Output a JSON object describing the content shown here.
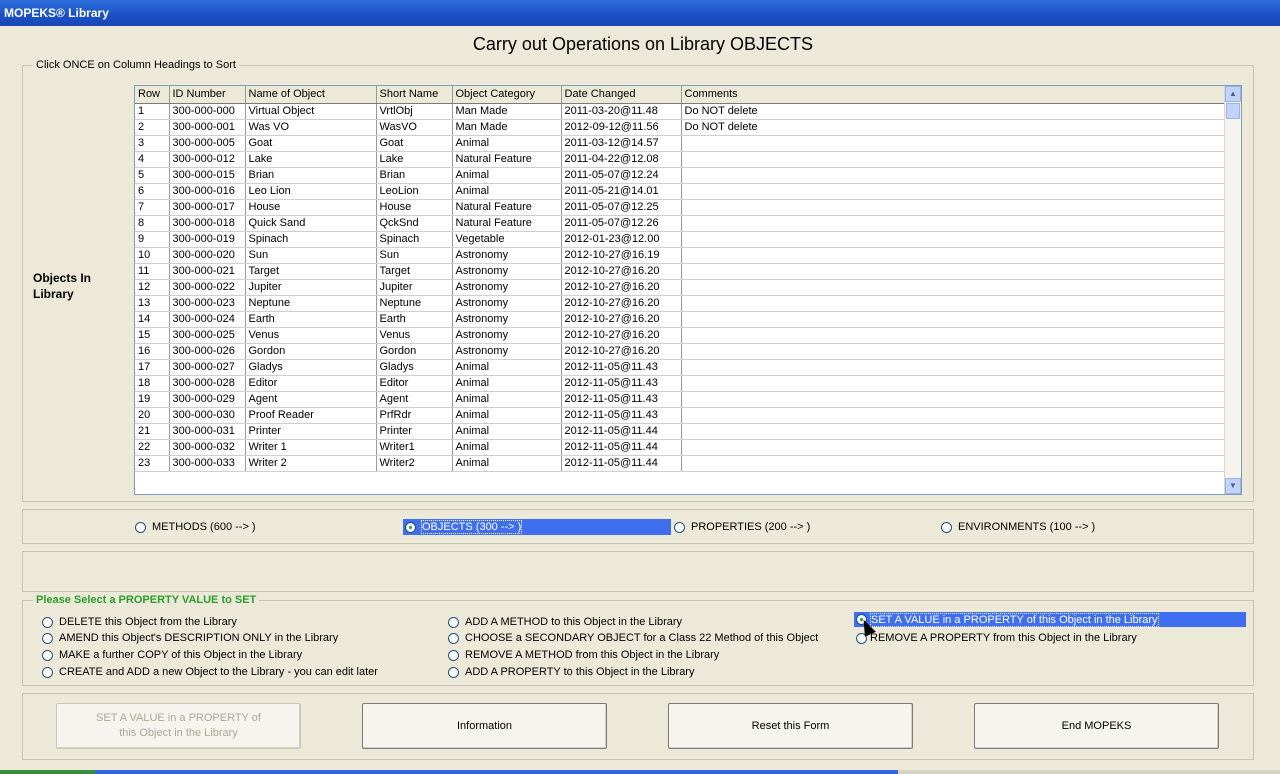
{
  "window": {
    "title": "MOPEKS® Library"
  },
  "heading": "Carry out Operations on Library OBJECTS",
  "sort_group": {
    "legend": "Click ONCE on Column Headings to Sort",
    "side_label": "Objects In Library"
  },
  "table": {
    "columns": [
      "Row",
      "ID Number",
      "Name of Object",
      "Short Name",
      "Object Category",
      "Date Changed",
      "Comments"
    ],
    "rows": [
      [
        "1",
        "300-000-000",
        "Virtual Object",
        "VrtlObj",
        "Man Made",
        "2011-03-20@11.48",
        "Do NOT delete"
      ],
      [
        "2",
        "300-000-001",
        "Was VO",
        "WasVO",
        "Man Made",
        "2012-09-12@11.56",
        "Do NOT delete"
      ],
      [
        "3",
        "300-000-005",
        "Goat",
        "Goat",
        "Animal",
        "2011-03-12@14.57",
        ""
      ],
      [
        "4",
        "300-000-012",
        "Lake",
        "Lake",
        "Natural Feature",
        "2011-04-22@12.08",
        ""
      ],
      [
        "5",
        "300-000-015",
        "Brian",
        "Brian",
        "Animal",
        "2011-05-07@12.24",
        ""
      ],
      [
        "6",
        "300-000-016",
        "Leo Lion",
        "LeoLion",
        "Animal",
        "2011-05-21@14.01",
        ""
      ],
      [
        "7",
        "300-000-017",
        "House",
        "House",
        "Natural Feature",
        "2011-05-07@12.25",
        ""
      ],
      [
        "8",
        "300-000-018",
        "Quick Sand",
        "QckSnd",
        "Natural Feature",
        "2011-05-07@12.26",
        ""
      ],
      [
        "9",
        "300-000-019",
        "Spinach",
        "Spinach",
        "Vegetable",
        "2012-01-23@12.00",
        ""
      ],
      [
        "10",
        "300-000-020",
        "Sun",
        "Sun",
        "Astronomy",
        "2012-10-27@16.19",
        ""
      ],
      [
        "11",
        "300-000-021",
        "Target",
        "Target",
        "Astronomy",
        "2012-10-27@16.20",
        ""
      ],
      [
        "12",
        "300-000-022",
        "Jupiter",
        "Jupiter",
        "Astronomy",
        "2012-10-27@16.20",
        ""
      ],
      [
        "13",
        "300-000-023",
        "Neptune",
        "Neptune",
        "Astronomy",
        "2012-10-27@16.20",
        ""
      ],
      [
        "14",
        "300-000-024",
        "Earth",
        "Earth",
        "Astronomy",
        "2012-10-27@16.20",
        ""
      ],
      [
        "15",
        "300-000-025",
        "Venus",
        "Venus",
        "Astronomy",
        "2012-10-27@16.20",
        ""
      ],
      [
        "16",
        "300-000-026",
        "Gordon",
        "Gordon",
        "Astronomy",
        "2012-10-27@16.20",
        ""
      ],
      [
        "17",
        "300-000-027",
        "Gladys",
        "Gladys",
        "Animal",
        "2012-11-05@11.43",
        ""
      ],
      [
        "18",
        "300-000-028",
        "Editor",
        "Editor",
        "Animal",
        "2012-11-05@11.43",
        ""
      ],
      [
        "19",
        "300-000-029",
        "Agent",
        "Agent",
        "Animal",
        "2012-11-05@11.43",
        ""
      ],
      [
        "20",
        "300-000-030",
        "Proof Reader",
        "PrfRdr",
        "Animal",
        "2012-11-05@11.43",
        ""
      ],
      [
        "21",
        "300-000-031",
        "Printer",
        "Printer",
        "Animal",
        "2012-11-05@11.44",
        ""
      ],
      [
        "22",
        "300-000-032",
        "Writer 1",
        "Writer1",
        "Animal",
        "2012-11-05@11.44",
        ""
      ],
      [
        "23",
        "300-000-033",
        "Writer 2",
        "Writer2",
        "Animal",
        "2012-11-05@11.44",
        ""
      ]
    ]
  },
  "type_selector": {
    "methods": "METHODS (600 --> )",
    "objects": "OBJECTS (300 --> )",
    "properties": "PROPERTIES (200 --> )",
    "environments": "ENVIRONMENTS (100 --> )",
    "selected": "objects"
  },
  "operations": {
    "legend": "Please Select a PROPERTY VALUE to SET",
    "delete": "DELETE this Object from the Library",
    "amend": "AMEND this Object's DESCRIPTION ONLY in the Library",
    "copy": "MAKE a further COPY of this Object in the Library",
    "create": "CREATE and ADD a new Object to the Library - you can edit later",
    "add_method": "ADD A METHOD to this Object in the Library",
    "choose_secondary": "CHOOSE a SECONDARY OBJECT for a Class 22 Method of this Object",
    "remove_method": "REMOVE A METHOD from this Object in the Library",
    "add_property": "ADD A PROPERTY to this Object in the Library",
    "set_value": "SET A VALUE in a PROPERTY of this Object in the Library",
    "remove_property": "REMOVE A PROPERTY from this Object in the Library",
    "selected": "set_value"
  },
  "buttons": {
    "action": "SET A VALUE in a PROPERTY of this Object in the Library",
    "information": "Information",
    "reset": "Reset this Form",
    "end": "End MOPEKS"
  },
  "colors": {
    "selection": "#3f6fef",
    "legend_green": "#2a9e2a",
    "titlebar": "#1b50c4"
  }
}
